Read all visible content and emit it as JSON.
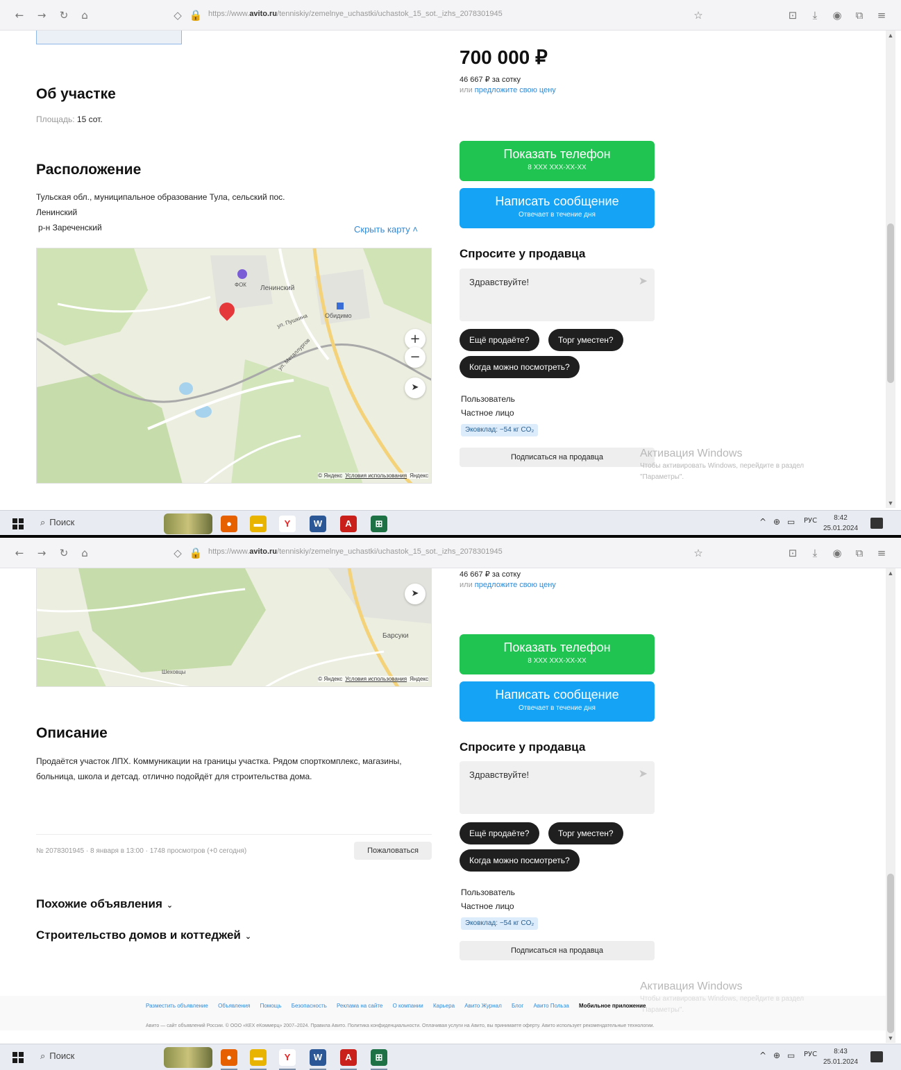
{
  "browser": {
    "url_prefix": "https://www.",
    "url_domain": "avito.ru",
    "url_path": "/tenniskiy/zemelnye_uchastki/uchastok_15_sot._izhs_2078301945"
  },
  "taskbar": {
    "search_label": "Поиск",
    "lang": "РУС",
    "time1": "8:42",
    "time2": "8:43",
    "date": "25.01.2024"
  },
  "listing": {
    "price": "700 000 ₽",
    "price_per": "46 667 ₽ за сотку",
    "price_offer_prefix": "или",
    "price_offer_link": "предложите свою цену",
    "about_title": "Об участке",
    "area_label": "Площадь:",
    "area_value": "15 сот.",
    "location_title": "Расположение",
    "address_line1": "Тульская обл., муниципальное образование Тула, сельский пос.",
    "address_line2": "Ленинский",
    "district": "р-н Зареченский",
    "hide_map": "Скрыть карту ˄",
    "description_title": "Описание",
    "description": "Продаётся участок ЛПХ. Коммуникации на границы участка. Рядом спорткомплекс, магазины, больница, школа и детсад. отлично подойдёт для строительства дома.",
    "meta": "№ 2078301945 · 8 января в 13:00 · 1748 просмотров (+0 сегодня)",
    "report": "Пожаловаться",
    "similar": "Похожие объявления",
    "construction": "Строительство домов и коттеджей"
  },
  "contact": {
    "show_phone": "Показать телефон",
    "phone_mask": "8 XXX XXX-XX-XX",
    "write_message": "Написать сообщение",
    "reply_time": "Отвечает в течение дня",
    "ask_title": "Спросите у продавца",
    "ask_placeholder": "Здравствуйте!",
    "chips": [
      "Ещё продаёте?",
      "Торг уместен?",
      "Когда можно посмотреть?"
    ],
    "seller_name": "Пользователь",
    "seller_type": "Частное лицо",
    "eco": "Эковклад: −54 кг CO₂",
    "subscribe": "Подписаться на продавца"
  },
  "map": {
    "labels": [
      "Ленинский",
      "Обидимо",
      "ФОК",
      "Барсуки",
      "Шеховцы",
      "ул. Пушкина",
      "ул. Металлургов"
    ],
    "copyright": "© Яндекс",
    "terms": "Условия использования",
    "brand": "Яндекс"
  },
  "windows_watermark": {
    "title": "Активация Windows",
    "line1": "Чтобы активировать Windows, перейдите в раздел",
    "line2": "\"Параметры\"."
  },
  "footer": {
    "links": [
      "Разместить объявление",
      "Объявления",
      "Помощь",
      "Безопасность",
      "Реклама на сайте",
      "О компании",
      "Карьера",
      "Авито Журнал",
      "Блог",
      "Авито Польза",
      "Мобильное приложение"
    ],
    "legal": "Авито — сайт объявлений России. © ООО «КЕХ еКоммерц» 2007–2024. Правила Авито. Политика конфиденциальности. Оплачивая услуги на Авито, вы принимаете оферту. Авито использует рекомендательные технологии."
  },
  "colors": {
    "green_button": "#1fc451",
    "blue_button": "#15a3f5",
    "link": "#2f8ad8",
    "map_pin": "#e5383b"
  }
}
